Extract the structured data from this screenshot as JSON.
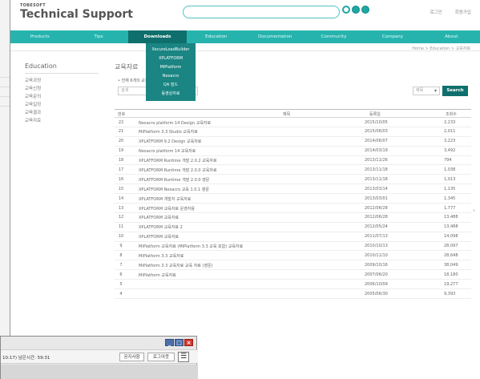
{
  "header": {
    "brand_small": "TOBESOFT",
    "brand_title": "Technical Support",
    "top_links": [
      "로그인",
      "회원가입"
    ]
  },
  "nav": {
    "items": [
      "Products",
      "Tips",
      "Downloads",
      "Education",
      "Documentation",
      "Community",
      "Company",
      "About"
    ]
  },
  "dropdown": {
    "items": [
      "XecureLoadBuilder",
      "XPLATFORM",
      "MiPlatform",
      "Nexacro",
      "QA 빌드",
      "동영상자료"
    ]
  },
  "breadcrumb": "Home > Education > 교육자료",
  "sidebar": {
    "title": "Education",
    "items": [
      "교육과정",
      "교육신청",
      "교육문의",
      "교육일정",
      "교육결과",
      "교육자료"
    ]
  },
  "content": {
    "title": "교육자료",
    "filter_text": "• 전체 6개의 교육자료가 등록되어 있습니다.",
    "filter_placeholder": "검색",
    "select_value": "제목",
    "search_label": "Search"
  },
  "table": {
    "headers": [
      "번호",
      "제목",
      "등록일",
      "조회수"
    ],
    "rows": [
      {
        "no": "22",
        "title": "Nexacro platform 14 Design 교육자료",
        "date": "2015/10/05",
        "views": "2,233"
      },
      {
        "no": "21",
        "title": "MiPlatform 3.3 Studio 교육자료",
        "date": "2015/06/03",
        "views": "2,011"
      },
      {
        "no": "20",
        "title": "XPLATFORM 9.2 Design 교육자료",
        "date": "2014/06/07",
        "views": "3,223"
      },
      {
        "no": "19",
        "title": "Nexacro platform 14 교육자료",
        "date": "2014/03/19",
        "views": "3,492"
      },
      {
        "no": "18",
        "title": "XPLATFORM Runtime 개발 2.0.2 교육자료",
        "date": "2013/11/26",
        "views": "794"
      },
      {
        "no": "17",
        "title": "XPLATFORM Runtime 개발 2.0.0 교육자료",
        "date": "2013/11/18",
        "views": "1,038"
      },
      {
        "no": "16",
        "title": "XPLATFORM Runtime 개발 2.0.0 영문",
        "date": "2013/11/18",
        "views": "1,013"
      },
      {
        "no": "15",
        "title": "XPLATFORM Nexacro 교육 1.0.1 영문",
        "date": "2013/03/14",
        "views": "1,135"
      },
      {
        "no": "14",
        "title": "XPLATFORM 개발자 교육자료",
        "date": "2013/03/01",
        "views": "1,345"
      },
      {
        "no": "13",
        "title": "XPLATFORM 교육자료 운영자용",
        "date": "2012/06/28",
        "views": "1,777"
      },
      {
        "no": "12",
        "title": "XPLATFORM 교육자료",
        "date": "2012/06/28",
        "views": "13,488"
      },
      {
        "no": "11",
        "title": "XPLATFORM 교육자료 2",
        "date": "2012/05/24",
        "views": "13,488"
      },
      {
        "no": "10",
        "title": "XPLATFORM 교육자료",
        "date": "2011/07/13",
        "views": "14,098"
      },
      {
        "no": "9",
        "title": "MiPlatform 교육자료 (MiPlatform 3.3 교육 포함) 교육자료",
        "date": "2010/10/13",
        "views": "28,097"
      },
      {
        "no": "8",
        "title": "MiPlatform 3.3 교육자료",
        "date": "2010/11/10",
        "views": "28,648"
      },
      {
        "no": "7",
        "title": "MiPlatform 3.3 교육자료 교육 자료 (영문)",
        "date": "2009/10/16",
        "views": "38,049"
      },
      {
        "no": "6",
        "title": "MiPlatform 교육자료",
        "date": "2007/06/20",
        "views": "18,180"
      },
      {
        "no": "5",
        "title": "",
        "date": "2006/10/09",
        "views": "19,277"
      },
      {
        "no": "4",
        "title": "",
        "date": "2005/06/30",
        "views": "9,393"
      }
    ]
  },
  "popup": {
    "time_text": "10:17)  남은시간: 59:31",
    "notice_label": "공지사항",
    "logout_label": "로그아웃",
    "menu_icon": "hamburger-icon",
    "window_controls": {
      "minimize": "_",
      "maximize": "□",
      "close": "×"
    }
  }
}
